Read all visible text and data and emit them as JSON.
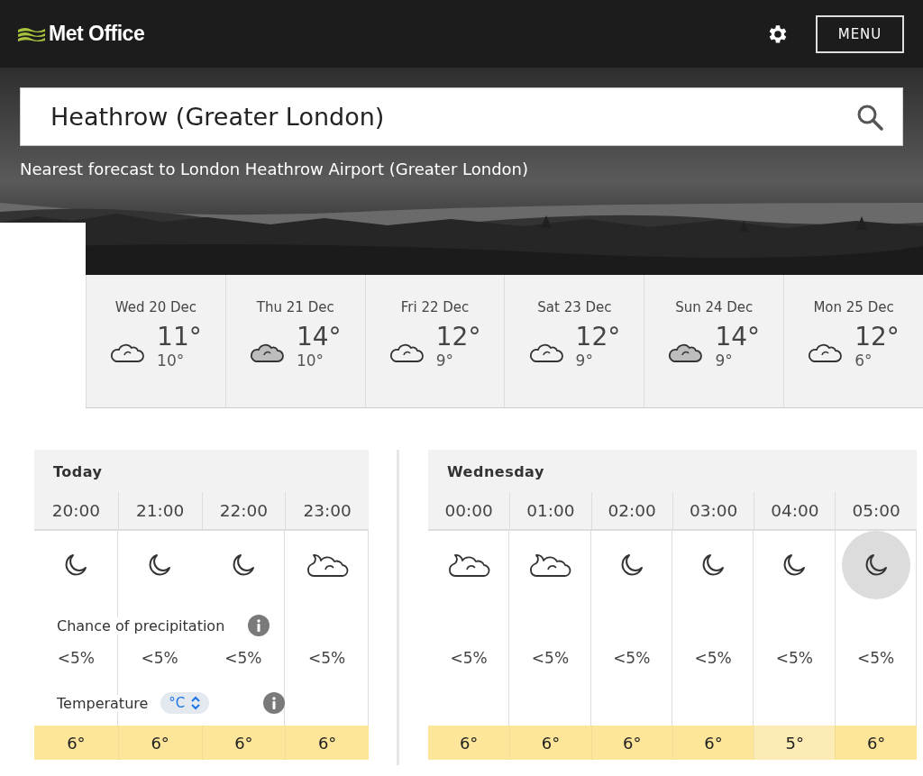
{
  "header": {
    "logo": "Met Office",
    "menu": "MENU"
  },
  "search": {
    "value": "Heathrow (Greater London)"
  },
  "subtitle": "Nearest forecast to London Heathrow Airport (Greater London)",
  "days": [
    {
      "date": "Wed 20 Dec",
      "high": "11°",
      "low": "10°",
      "kind": "cloud"
    },
    {
      "date": "Thu 21 Dec",
      "high": "14°",
      "low": "10°",
      "kind": "grey-cloud"
    },
    {
      "date": "Fri 22 Dec",
      "high": "12°",
      "low": "9°",
      "kind": "cloud"
    },
    {
      "date": "Sat 23 Dec",
      "high": "12°",
      "low": "9°",
      "kind": "cloud"
    },
    {
      "date": "Sun 24 Dec",
      "high": "14°",
      "low": "9°",
      "kind": "grey-cloud"
    },
    {
      "date": "Mon 25 Dec",
      "high": "12°",
      "low": "6°",
      "kind": "cloud"
    }
  ],
  "hourly": [
    {
      "title": "Today",
      "precip_label": "Chance of precipitation",
      "temp_label": "Temperature",
      "unit": "°C",
      "hours": [
        {
          "time": "20:00",
          "kind": "moon",
          "precip": "<5%",
          "temp": "6°",
          "color": "#fde59a",
          "selected": false
        },
        {
          "time": "21:00",
          "kind": "moon",
          "precip": "<5%",
          "temp": "6°",
          "color": "#fde59a",
          "selected": false
        },
        {
          "time": "22:00",
          "kind": "moon",
          "precip": "<5%",
          "temp": "6°",
          "color": "#fde59a",
          "selected": false
        },
        {
          "time": "23:00",
          "kind": "cloudy-night",
          "precip": "<5%",
          "temp": "6°",
          "color": "#fde59a",
          "selected": false
        }
      ]
    },
    {
      "title": "Wednesday",
      "hours": [
        {
          "time": "00:00",
          "kind": "cloudy-night",
          "precip": "<5%",
          "temp": "6°",
          "color": "#fde59a",
          "selected": false
        },
        {
          "time": "01:00",
          "kind": "cloudy-night",
          "precip": "<5%",
          "temp": "6°",
          "color": "#fde59a",
          "selected": false
        },
        {
          "time": "02:00",
          "kind": "moon",
          "precip": "<5%",
          "temp": "6°",
          "color": "#fde59a",
          "selected": false
        },
        {
          "time": "03:00",
          "kind": "moon",
          "precip": "<5%",
          "temp": "6°",
          "color": "#fde59a",
          "selected": false
        },
        {
          "time": "04:00",
          "kind": "moon",
          "precip": "<5%",
          "temp": "5°",
          "color": "#fdebb5",
          "selected": false
        },
        {
          "time": "05:00",
          "kind": "moon",
          "precip": "<5%",
          "temp": "6°",
          "color": "#fde59a",
          "selected": true
        }
      ]
    }
  ]
}
